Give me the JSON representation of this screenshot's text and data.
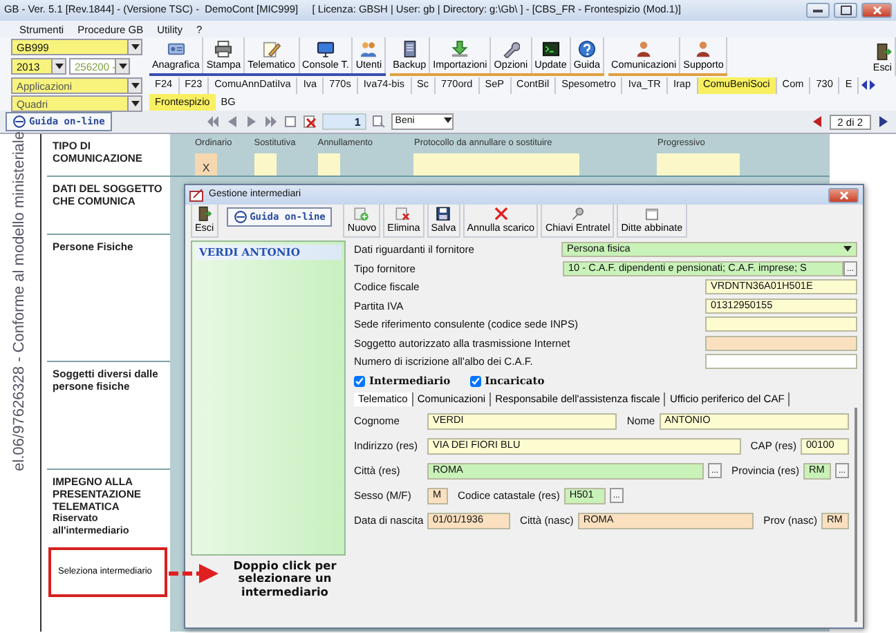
{
  "window": {
    "title": "GB - Ver. 5.1 [Rev.1844] - (Versione TSC) -  DemoCont [MIC999]     [ Licenza: GBSH | User: gb | Directory: g:\\Gb\\ ] - [CBS_FR - Frontespizio (Mod.1)]"
  },
  "menu": [
    "Strumenti",
    "Procedure GB",
    "Utility",
    "?"
  ],
  "selectors": {
    "company": "GB999",
    "year": "2013",
    "code": "256200 -",
    "applications": "Applicazioni",
    "frames": "Quadri"
  },
  "toolbar_groups": [
    [
      {
        "label": "Anagrafica"
      },
      {
        "label": "Stampa"
      },
      {
        "label": "Telematico"
      },
      {
        "label": "Console T."
      },
      {
        "label": "Utenti"
      }
    ],
    [
      {
        "label": "Backup"
      },
      {
        "label": "Importazioni"
      },
      {
        "label": "Opzioni"
      },
      {
        "label": "Update"
      },
      {
        "label": "Guida"
      }
    ],
    [
      {
        "label": "Comunicazioni"
      },
      {
        "label": "Supporto"
      }
    ]
  ],
  "exit_button": {
    "label": "Esci"
  },
  "modules": [
    {
      "label": "F24",
      "selected": false
    },
    {
      "label": "F23",
      "selected": false
    },
    {
      "label": "ComuAnnDatiIva",
      "selected": false
    },
    {
      "label": "Iva",
      "selected": false
    },
    {
      "label": "770s",
      "selected": false
    },
    {
      "label": "Iva74-bis",
      "selected": false
    },
    {
      "label": "Sc",
      "selected": false
    },
    {
      "label": "770ord",
      "selected": false
    },
    {
      "label": "SeP",
      "selected": false
    },
    {
      "label": "ContBil",
      "selected": false
    },
    {
      "label": "Spesometro",
      "selected": false
    },
    {
      "label": "Iva_TR",
      "selected": false
    },
    {
      "label": "Irap",
      "selected": false
    },
    {
      "label": "ComuBeniSoci",
      "selected": true
    },
    {
      "label": "Com",
      "selected": false
    },
    {
      "label": "730",
      "selected": false
    },
    {
      "label": "E",
      "selected": false
    }
  ],
  "frame_tabs": [
    {
      "label": "Frontespizio",
      "selected": true
    },
    {
      "label": "BG",
      "selected": false
    }
  ],
  "navigator": {
    "help": "Guida on-line",
    "page": "1",
    "section": "Beni",
    "pages": "2 di 2"
  },
  "form": {
    "side_text": "el.06/97626328 - Conforme al modello ministeriale",
    "sections": [
      {
        "title": "TIPO DI COMUNICAZIONE"
      },
      {
        "title": "DATI DEL SOGGETTO CHE COMUNICA"
      },
      {
        "title": "Persone Fisiche"
      },
      {
        "title": "Soggetti diversi dalle persone fisiche"
      },
      {
        "title": "IMPEGNO ALLA PRESENTAZIONE TELEMATICA",
        "note": "Riservato all'intermediario"
      }
    ],
    "communication_types": [
      {
        "label": "Ordinario",
        "value": "X",
        "selected": true
      },
      {
        "label": "Sostitutiva",
        "selected": false
      },
      {
        "label": "Annullamento",
        "selected": false
      }
    ],
    "protocol_label": "Protocollo da annullare o sostituire",
    "progressive_label": "Progressivo",
    "select_button": "Seleziona intermediario"
  },
  "dialog": {
    "title": "Gestione intermediari",
    "help": "Guida on-line",
    "exit": {
      "label": "Esci"
    },
    "toolbar": [
      {
        "label": "Nuovo"
      },
      {
        "label": "Elimina"
      },
      {
        "label": "Salva"
      },
      {
        "label": "Annulla scarico"
      },
      {
        "label": "Chiavi Entratel"
      },
      {
        "label": "Ditte abbinate"
      }
    ],
    "list": [
      {
        "name": "VERDI ANTONIO",
        "selected": true
      }
    ],
    "hint": "Doppio click per selezionare un intermediario",
    "supplier_rows": [
      {
        "label": "Dati riguardanti il fornitore",
        "value": "Persona fisica",
        "kind": "select"
      },
      {
        "label": "Tipo fornitore",
        "value": "10 - C.A.F. dipendenti e pensionati; C.A.F. imprese; S",
        "kind": "lookup",
        "picker": "..."
      },
      {
        "label": "Codice fiscale",
        "value": "VRDNTN36A01H501E",
        "kind": "text"
      },
      {
        "label": "Partita IVA",
        "value": "01312950155",
        "kind": "text"
      },
      {
        "label": "Sede riferimento consulente (codice sede INPS)",
        "kind": "text"
      },
      {
        "label": "Soggetto autorizzato alla trasmissione Internet",
        "kind": "required"
      },
      {
        "label": "Numero di iscrizione all'albo dei C.A.F.",
        "kind": "plain"
      }
    ],
    "checkboxes": [
      {
        "label": "Intermediario",
        "checked": true
      },
      {
        "label": "Incaricato",
        "checked": true
      }
    ],
    "tabs": [
      {
        "label": "Telematico",
        "selected": true
      },
      {
        "label": "Comunicazioni",
        "selected": false
      },
      {
        "label": "Responsabile dell'assistenza fiscale",
        "selected": false
      },
      {
        "label": "Ufficio periferico del CAF",
        "selected": false
      }
    ],
    "person_rows": [
      [
        {
          "label": "Cognome",
          "value": "VERDI",
          "kind": "text"
        },
        {
          "label": "Nome",
          "value": "ANTONIO",
          "kind": "text"
        }
      ],
      [
        {
          "label": "Indirizzo (res)",
          "value": "VIA DEI FIORI BLU",
          "kind": "text"
        },
        {
          "label": "CAP (res)",
          "value": "00100",
          "kind": "text"
        }
      ],
      [
        {
          "label": "Città (res)",
          "value": "ROMA",
          "kind": "lookup",
          "picker": "..."
        },
        {
          "label": "Provincia (res)",
          "value": "RM",
          "kind": "lookup",
          "picker": "..."
        }
      ],
      [
        {
          "label": "Sesso (M/F)",
          "value": "M",
          "kind": "required"
        },
        {
          "label": "Codice catastale (res)",
          "value": "H501",
          "kind": "lookup",
          "picker": "..."
        }
      ],
      [
        {
          "label": "Data di nascita",
          "value": "01/01/1936",
          "kind": "required"
        },
        {
          "label": "Città (nasc)",
          "value": "ROMA",
          "kind": "required"
        },
        {
          "label": "Prov (nasc)",
          "value": "RM",
          "kind": "required"
        }
      ]
    ]
  }
}
